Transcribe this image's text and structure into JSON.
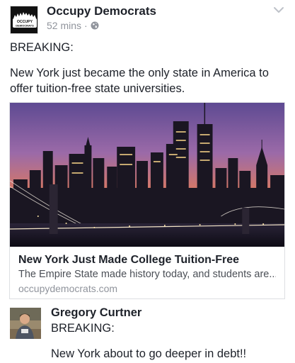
{
  "post": {
    "page_name": "Occupy Democrats",
    "timestamp": "52 mins",
    "separator": "·",
    "privacy_icon": "globe-icon",
    "menu_icon": "chevron-down-icon",
    "avatar": {
      "logo_line1": "OCCUPY",
      "logo_line2": "DEMOCRATS"
    },
    "text_lines": [
      "BREAKING:",
      "New York just became the only state in America to offer tuition-free state universities."
    ]
  },
  "link_preview": {
    "image": "new-york-skyline-sunset-photo",
    "title": "New York Just Made College Tuition-Free",
    "description": "The Empire State made history today, and students are...",
    "domain": "occupydemocrats.com"
  },
  "comment": {
    "author": "Gregory Curtner",
    "lines": [
      "BREAKING:",
      "New York about to go deeper in debt!!"
    ]
  },
  "colors": {
    "text_primary": "#1d2129",
    "text_secondary": "#90949c",
    "card_border": "#dddfe2",
    "sky_top": "#7a5aa8",
    "sky_bottom": "#f08a4b"
  }
}
